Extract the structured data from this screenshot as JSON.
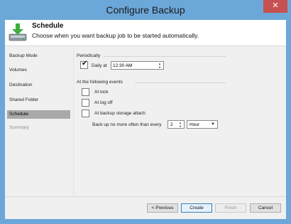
{
  "window": {
    "title": "Configure Backup",
    "close_glyph": "✕"
  },
  "header": {
    "title": "Schedule",
    "subtitle": "Choose when you want backup job to be started automatically.",
    "icon": "download-arrow-drive-icon"
  },
  "sidebar": {
    "items": [
      {
        "label": "Backup Mode",
        "state": "normal"
      },
      {
        "label": "Volumes",
        "state": "normal"
      },
      {
        "label": "Destination",
        "state": "normal"
      },
      {
        "label": "Shared Folder",
        "state": "normal"
      },
      {
        "label": "Schedule",
        "state": "active"
      },
      {
        "label": "Summary",
        "state": "disabled"
      }
    ]
  },
  "periodically": {
    "group_label": "Periodically",
    "daily": {
      "checked": true,
      "label": "Daily at",
      "time": "12:30 AM"
    }
  },
  "events": {
    "group_label": "At the following events",
    "at_lock": {
      "checked": false,
      "label": "At lock"
    },
    "at_logoff": {
      "checked": false,
      "label": "At log off"
    },
    "at_storage_attach": {
      "checked": false,
      "label": "At backup storage attach"
    },
    "throttle": {
      "label": "Back up no more often than every",
      "value": "2",
      "unit": "Hour"
    }
  },
  "footer": {
    "previous": "< Previous",
    "create": "Create",
    "finish": "Finish",
    "cancel": "Cancel"
  },
  "colors": {
    "title_bar": "#6ca7d9",
    "close_button": "#c75050",
    "selected_nav": "#a9a9a9",
    "primary_button_border": "#3c7fb1"
  }
}
